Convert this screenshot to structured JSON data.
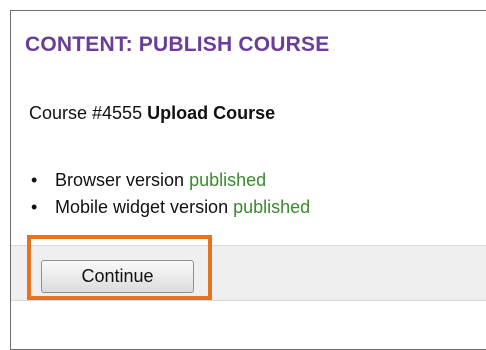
{
  "panel": {
    "title": "CONTENT: PUBLISH COURSE"
  },
  "course": {
    "prefix": "Course #4555",
    "name": "Upload Course"
  },
  "versions": [
    {
      "label": "Browser version",
      "status": "published"
    },
    {
      "label": "Mobile widget version",
      "status": "published"
    }
  ],
  "actions": {
    "continue_label": "Continue"
  },
  "colors": {
    "title": "#6a3d99",
    "status_published": "#3a8a2e",
    "highlight": "#e8731f"
  }
}
